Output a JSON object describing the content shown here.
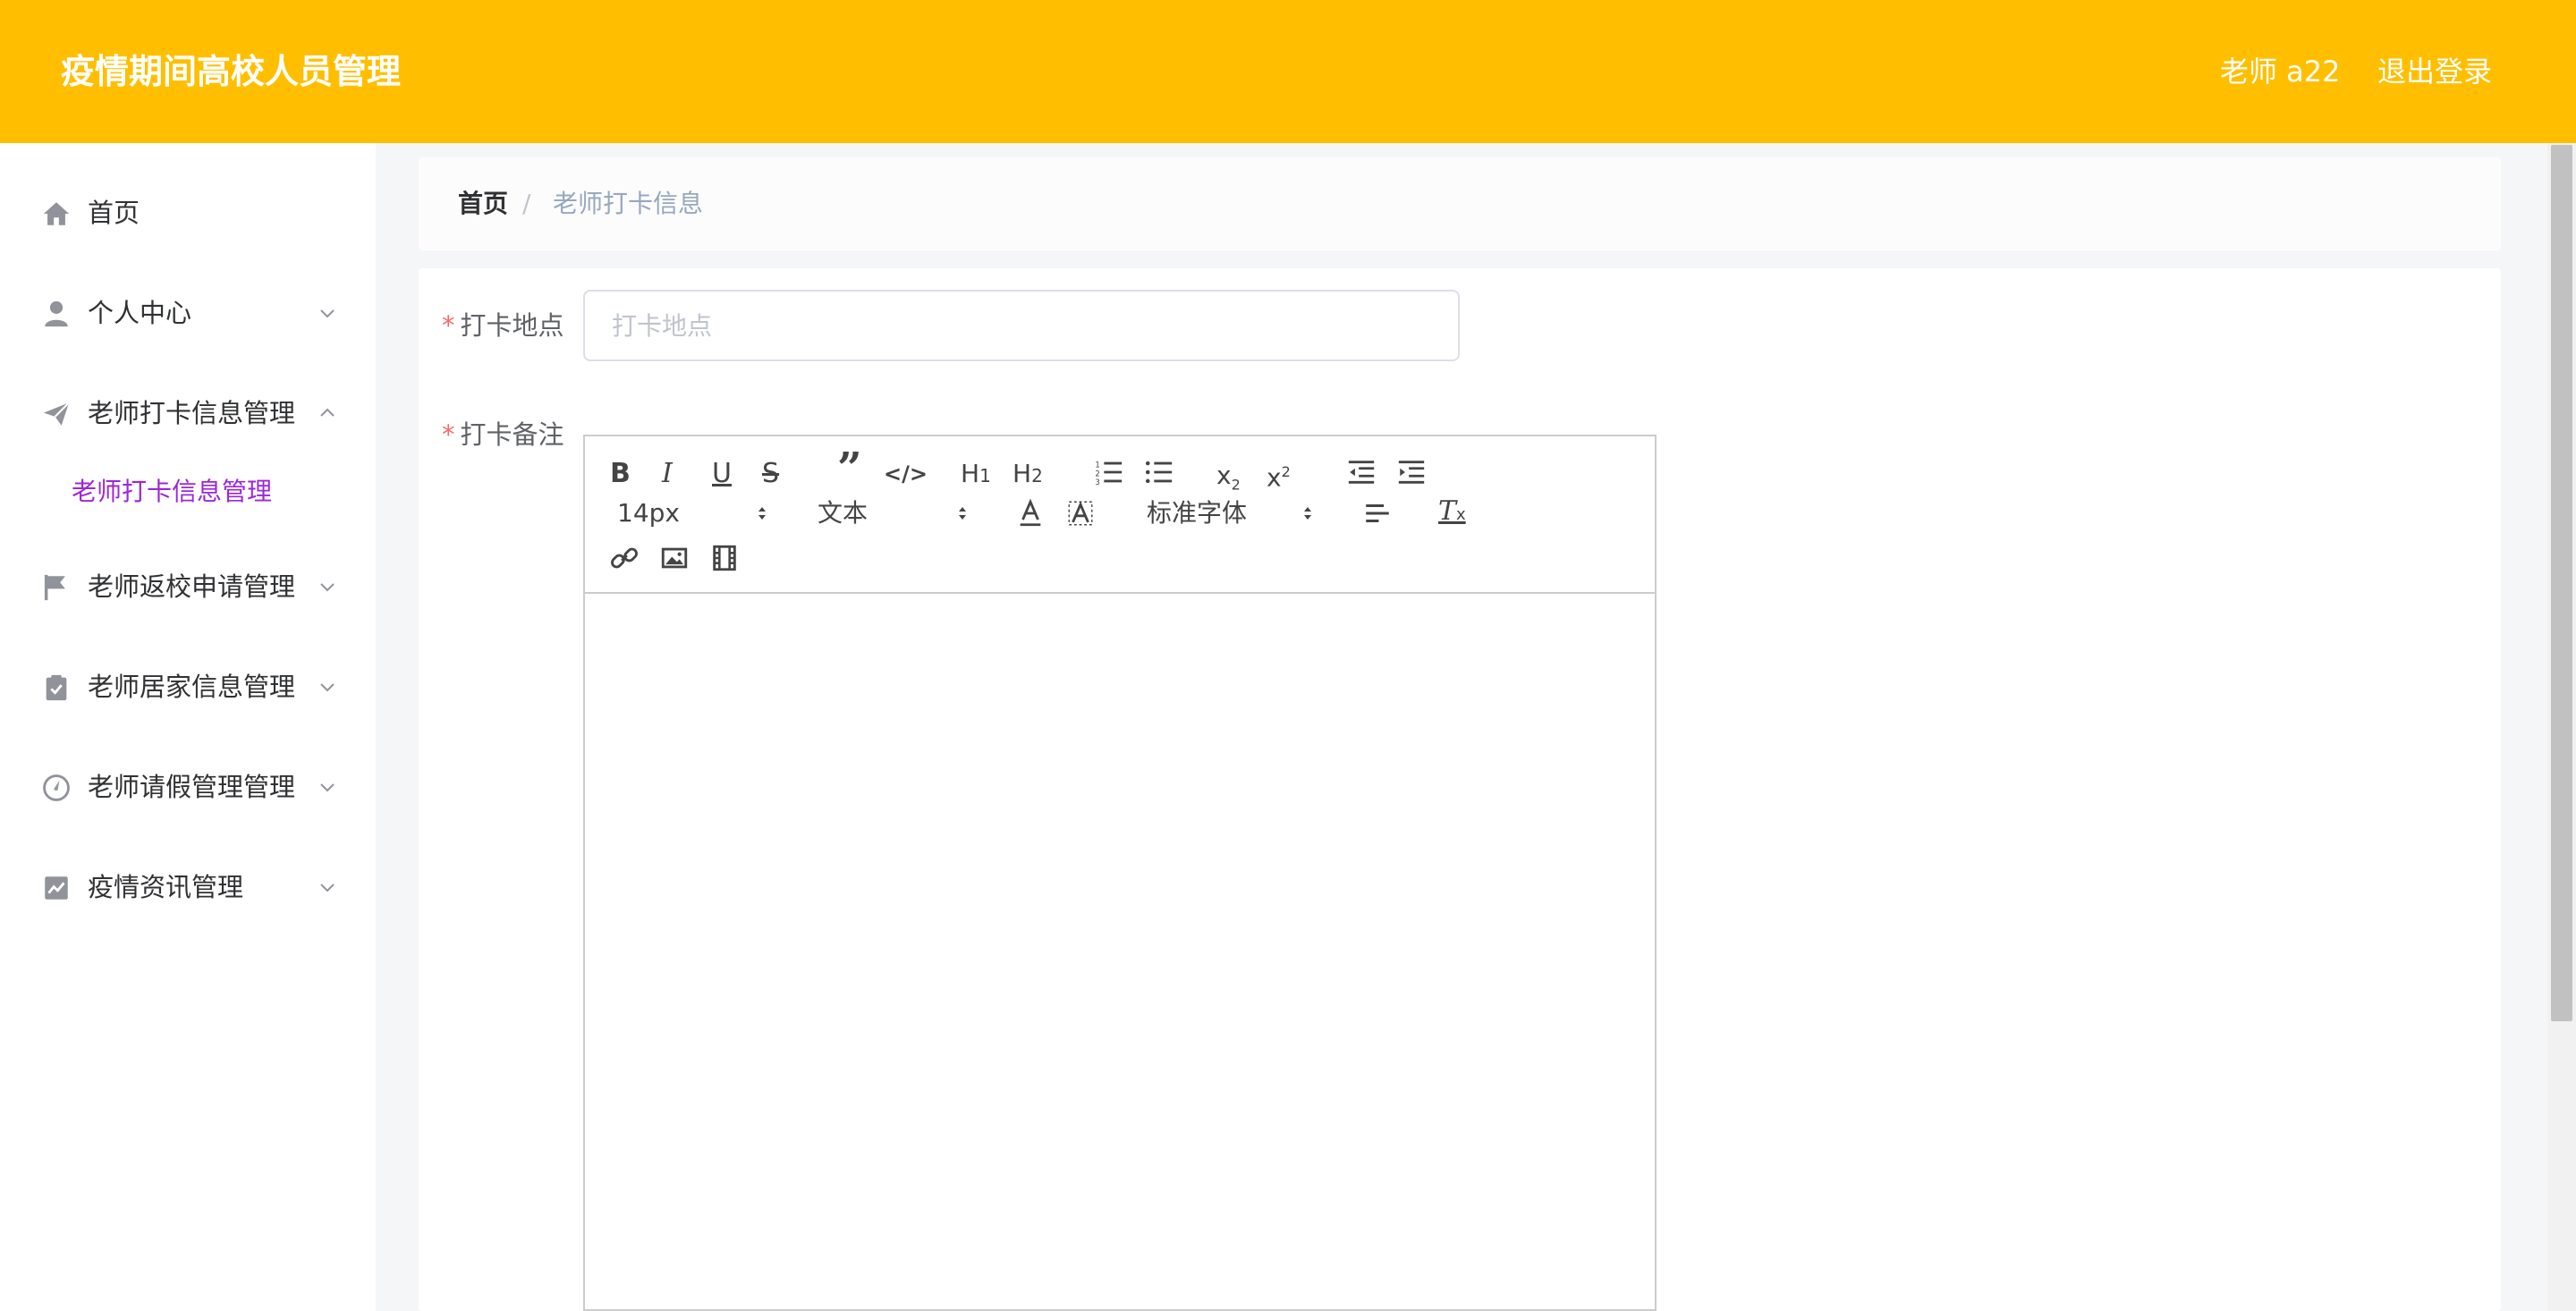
{
  "app": {
    "title": "疫情期间高校人员管理"
  },
  "header": {
    "user": "老师 a22",
    "logout": "退出登录"
  },
  "sidebar": {
    "items": [
      {
        "label": "首页",
        "icon": "home-icon"
      },
      {
        "label": "个人中心",
        "icon": "user-icon",
        "expanded": false
      },
      {
        "label": "老师打卡信息管理",
        "icon": "paper-plane-icon",
        "expanded": true,
        "children": [
          {
            "label": "老师打卡信息管理",
            "active": true
          }
        ]
      },
      {
        "label": "老师返校申请管理",
        "icon": "flag-icon",
        "expanded": false
      },
      {
        "label": "老师居家信息管理",
        "icon": "clipboard-check-icon",
        "expanded": false
      },
      {
        "label": "老师请假管理管理",
        "icon": "compass-icon",
        "expanded": false
      },
      {
        "label": "疫情资讯管理",
        "icon": "chart-icon",
        "expanded": false
      }
    ]
  },
  "breadcrumb": {
    "home": "首页",
    "separator": "/",
    "current": "老师打卡信息"
  },
  "form": {
    "required_mark": "*",
    "location": {
      "label": "打卡地点",
      "placeholder": "打卡地点",
      "value": ""
    },
    "note": {
      "label": "打卡备注",
      "value": ""
    }
  },
  "editor": {
    "size_picker": "14px",
    "header_picker": "文本",
    "font_picker": "标准字体",
    "toolbar_icons": [
      "bold-icon",
      "italic-icon",
      "underline-icon",
      "strike-icon",
      "blockquote-icon",
      "code-block-icon",
      "h1-icon",
      "h2-icon",
      "ordered-list-icon",
      "bullet-list-icon",
      "subscript-icon",
      "superscript-icon",
      "outdent-icon",
      "indent-icon",
      "text-color-icon",
      "background-color-icon",
      "align-icon",
      "clean-format-icon",
      "link-icon",
      "image-icon",
      "video-icon"
    ]
  },
  "colors": {
    "header_bg": "#ffbf00",
    "active_submenu": "#9c27d8",
    "required": "#f56c6c"
  }
}
